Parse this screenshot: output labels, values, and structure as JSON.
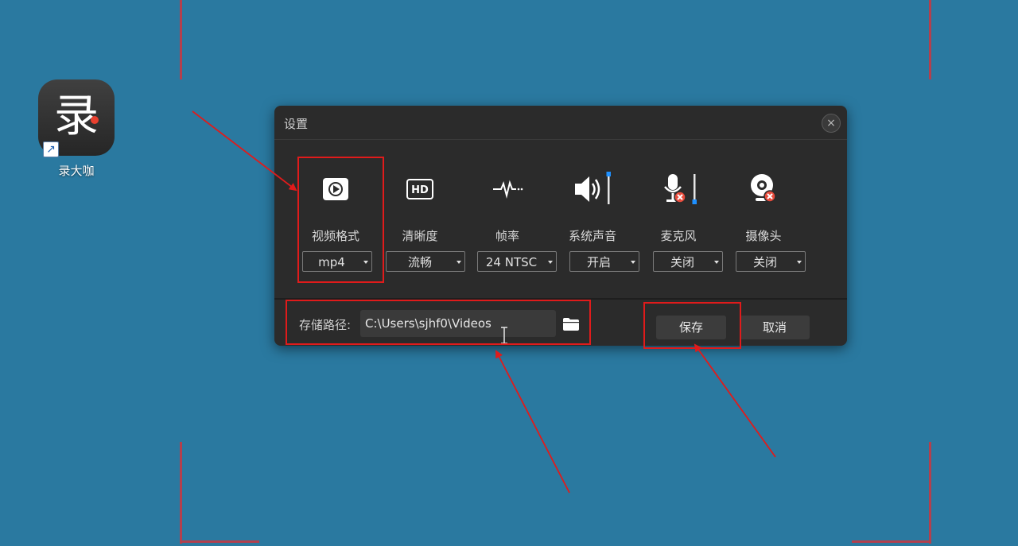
{
  "desktop": {
    "icon_label": "录大咖",
    "icon_glyph": "录"
  },
  "dialog": {
    "title": "设置",
    "close_glyph": "×",
    "options": [
      {
        "label": "视频格式",
        "value": "mp4",
        "icon": "video-format-icon"
      },
      {
        "label": "清晰度",
        "value": "流畅",
        "icon": "hd-icon"
      },
      {
        "label": "帧率",
        "value": "24 NTSC",
        "icon": "frame-rate-icon"
      },
      {
        "label": "系统声音",
        "value": "开启",
        "icon": "speaker-icon"
      },
      {
        "label": "麦克风",
        "value": "关闭",
        "icon": "microphone-muted-icon"
      },
      {
        "label": "摄像头",
        "value": "关闭",
        "icon": "webcam-disabled-icon"
      }
    ],
    "hd_text": "HD",
    "storage": {
      "label": "存储路径:",
      "value": "C:\\Users\\sjhf0\\Videos"
    },
    "save_label": "保存",
    "cancel_label": "取消"
  },
  "colors": {
    "desktop": "#2a79a0",
    "dialog": "#2b2b2b",
    "annotation": "#e01b1b",
    "accent": "#1e90ff"
  }
}
